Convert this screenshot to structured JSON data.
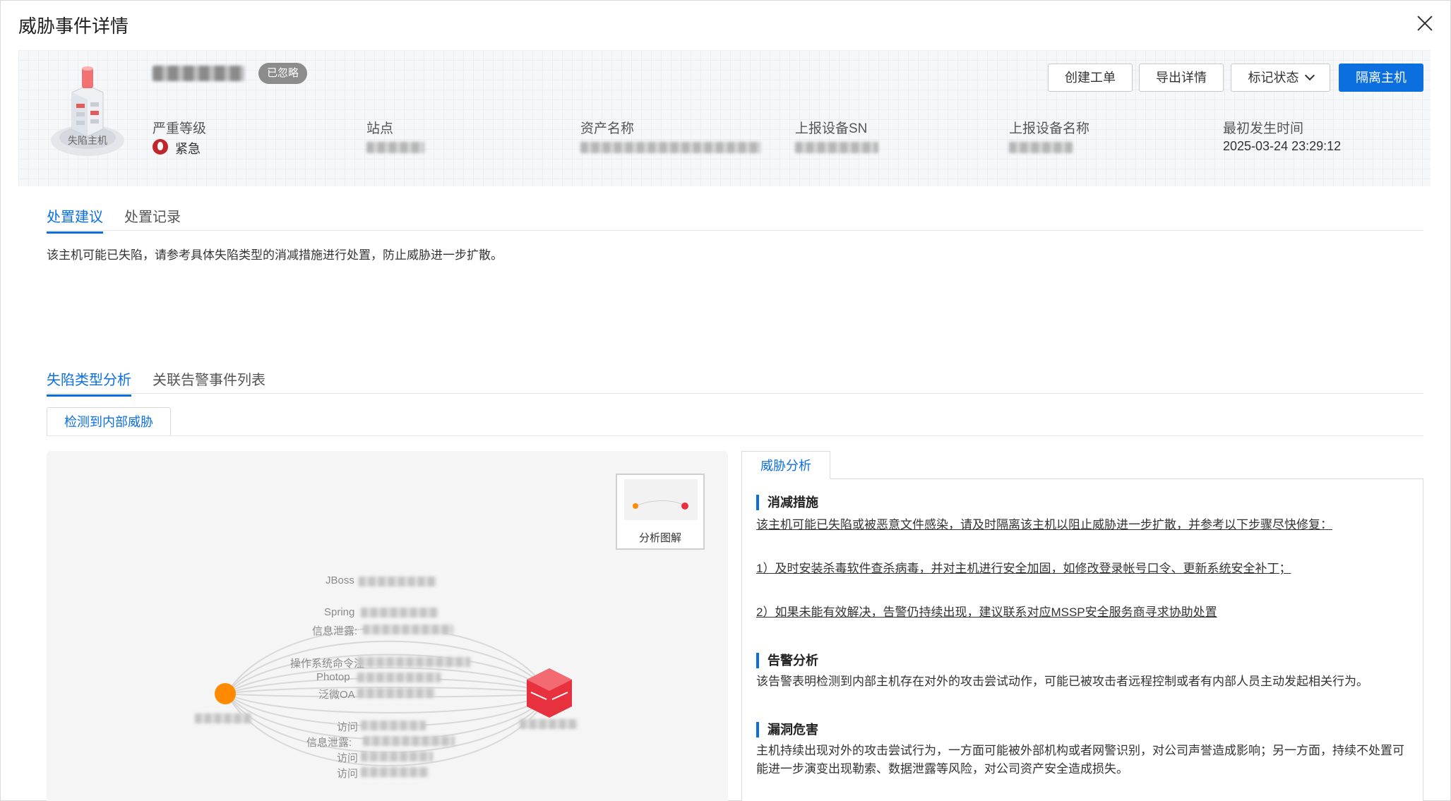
{
  "dialog": {
    "title": "威胁事件详情"
  },
  "header": {
    "host_icon_caption": "失陷主机",
    "status_badge": "已忽略",
    "fields": [
      {
        "label": "严重等级",
        "value": "紧急"
      },
      {
        "label": "站点",
        "value": ""
      },
      {
        "label": "资产名称",
        "value": ""
      },
      {
        "label": "上报设备SN",
        "value": ""
      },
      {
        "label": "上报设备名称",
        "value": ""
      },
      {
        "label": "最初发生时间",
        "value": "2025-03-24 23:29:12"
      }
    ],
    "buttons": {
      "create_ticket": "创建工单",
      "export_details": "导出详情",
      "mark_status": "标记状态",
      "isolate_host": "隔离主机"
    }
  },
  "tabs_top": [
    "处置建议",
    "处置记录"
  ],
  "advice_text": "该主机可能已失陷，请参考具体失陷类型的消减措施进行处置，防止威胁进一步扩散。",
  "tabs_bottom": [
    "失陷类型分析",
    "关联告警事件列表"
  ],
  "subtab": "检测到内部威胁",
  "graph": {
    "minimap_caption": "分析图解",
    "edge_labels": [
      "JBoss",
      "Spring",
      "信息泄露:",
      "操作系统命令注",
      "Photop",
      "泛微OA",
      "访问",
      "信息泄露:",
      "访问",
      "访问"
    ]
  },
  "analysis": {
    "tab": "威胁分析",
    "sections": [
      {
        "title": "消减措施",
        "lines": [
          "该主机可能已失陷或被恶意文件感染，请及时隔离该主机以阻止威胁进一步扩散，并参考以下步骤尽快修复：",
          "1）及时安装杀毒软件查杀病毒，并对主机进行安全加固，如修改登录帐号口令、更新系统安全补丁；",
          "2）如果未能有效解决，告警仍持续出现，建议联系对应MSSP安全服务商寻求协助处置"
        ]
      },
      {
        "title": "告警分析",
        "lines": [
          "该告警表明检测到内部主机存在对外的攻击尝试动作，可能已被攻击者远程控制或者有内部人员主动发起相关行为。"
        ]
      },
      {
        "title": "漏洞危害",
        "lines": [
          "主机持续出现对外的攻击尝试行为，一方面可能被外部机构或者网警识别，对公司声誉造成影响；另一方面，持续不处置可能进一步演变出现勒索、数据泄露等风险，对公司资产安全造成损失。"
        ]
      }
    ]
  },
  "colors": {
    "primary": "#0c6fe0",
    "source_node": "#ff8a00",
    "target_node": "#e8313f",
    "severity": "#c0262b"
  }
}
